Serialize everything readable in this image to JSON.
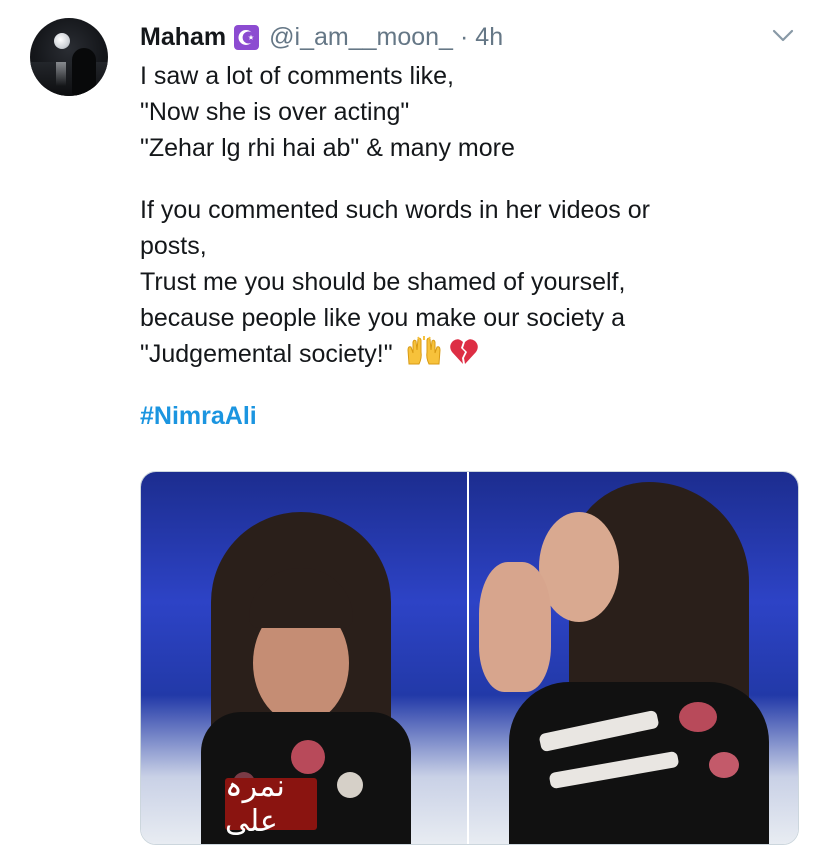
{
  "tweet": {
    "author_name": "Maham",
    "handle": "@i_am__moon_",
    "separator": "·",
    "time": "4h",
    "badge_icon": "crescent-star-icon",
    "badge_color": "#8c4bd1",
    "lines": [
      "I saw a lot of comments like,",
      "\"Now she is over acting\"",
      "\"Zehar lg rhi hai ab\" & many more",
      "",
      "If you commented such words in her videos or",
      "posts,",
      "Trust me you should be shamed of yourself,",
      "because people like you make our society a",
      "\"Judgemental society!\""
    ],
    "emojis": [
      "raising-hands-icon",
      "broken-heart-icon"
    ],
    "hashtag": "#NimraAli",
    "hashtag_color": "#1b95e0",
    "media": {
      "left_caption": "نمرہ علی"
    }
  }
}
